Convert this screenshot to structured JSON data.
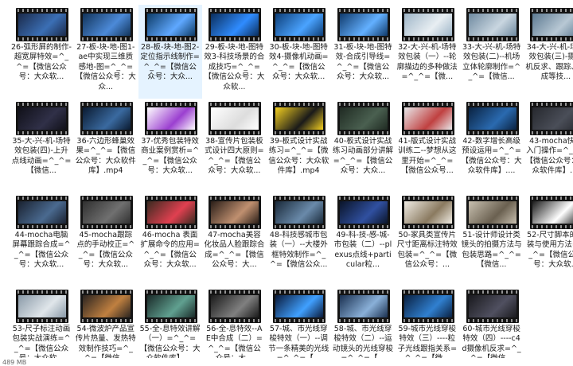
{
  "items": [
    {
      "label": "26-弧形屏的制作-超宽屏特效=^_^=【微信公众号：大众软...",
      "thumb": "#1b2a4a",
      "accent": "#3b6fb5"
    },
    {
      "label": "27-板-块-地-图1-ae中实现三维质感地-图=^_^=【微信公众号：大众...",
      "thumb": "#12345a",
      "accent": "#4c8ad8"
    },
    {
      "label": "28-板-块-地-图2-定位指示线制作=^_^=【微信公众号：大众...",
      "thumb": "#0d3b66",
      "accent": "#5fa8ff"
    },
    {
      "label": "29-板-块-地-图特效3-科技场景的合成技巧=^_^=【微信公众号：大众软...",
      "thumb": "#0b2e5c",
      "accent": "#2f8cff"
    },
    {
      "label": "30-板-块-地-图特效4-摄像机动画=^_^=【微信公众号：大众软...",
      "thumb": "#0e3f78",
      "accent": "#4aa3ff"
    },
    {
      "label": "31-板-块-地-图特效-合成引导线=^_^=【微信公众号：大众软...",
      "thumb": "#103a6b",
      "accent": "#63b0ff"
    },
    {
      "label": "32-大-兴-机-场特效包装（一）--轮廓描边的多种做法=^_^=【微...",
      "thumb": "#9fb6c8",
      "accent": "#e8eef2"
    },
    {
      "label": "33-大-兴-机-场特效包装(二)--机场立体轮廓制作=^_^=【微信...",
      "thumb": "#6f8aa0",
      "accent": "#c9d6e0"
    },
    {
      "label": "34-大-兴-机-场特效包装(三)-摄像机反求、跟踪、合成等技...",
      "thumb": "#5d7a92",
      "accent": "#b8c8d4"
    },
    {
      "label": "35-大-兴-机-场特效包装(四)-上升点线动画=^_^=【微信...",
      "thumb": "#101018",
      "accent": "#303048"
    },
    {
      "label": "36-六边形蜂巢效果=^_^=【微信公众号：大众软件库】.mp4",
      "thumb": "#0a1a30",
      "accent": "#3a6aa0"
    },
    {
      "label": "37-优秀包装特效商业案例赏析=^_^=【微信公众号：大众软...",
      "thumb": "#ffffff",
      "accent": "#9b3fd0"
    },
    {
      "label": "38-宣传片包装板式设计四大原则=^_^=【微信公众号：大众软...",
      "thumb": "#ffffff",
      "accent": "#dddddd"
    },
    {
      "label": "39-板式设计实战练习=^_^=【微信公众号：大众软件库】.mp4",
      "thumb": "#f5d020",
      "accent": "#1a1a1a"
    },
    {
      "label": "40-板式设计实战练习动画部分讲解=^_^=【微信公众号：大众...",
      "thumb": "#1f2a22",
      "accent": "#4a6050"
    },
    {
      "label": "41-版式设计实战训练二--梦想从这里开始=^_^=【微信公众号...",
      "thumb": "#e8e8ea",
      "accent": "#c04040"
    },
    {
      "label": "42-数字增长高级预设运用=^_^=【微信公众号：大众软件库】....",
      "thumb": "#0a2240",
      "accent": "#2a6ab0"
    },
    {
      "label": "43-mocha快速入门操作=^_^=【微信公众号：大众软件库】....",
      "thumb": "#26282e",
      "accent": "#4a4e58"
    },
    {
      "label": "44-mocha电脑屏幕跟踪合成=^_^=【微信公众号：大众软...",
      "thumb": "#1a2230",
      "accent": "#4a6a90"
    },
    {
      "label": "45-mocha跟踪点的手动校正=^_^=【微信公众号：大众软...",
      "thumb": "#303030",
      "accent": "#707070"
    },
    {
      "label": "46-mocha 表面扩展命令的应用=^_^=【微信公众号：大众软...",
      "thumb": "#3a2a20",
      "accent": "#e04050"
    },
    {
      "label": "47-mocha美容化妆品人脸跟踪合成=^_^=【微信公众号：大...",
      "thumb": "#2a1e18",
      "accent": "#c09070"
    },
    {
      "label": "48-科技感城市包装（一）--大楼外框特效制作=^_^=【微信公众...",
      "thumb": "#1a2a3a",
      "accent": "#6a8aaa"
    },
    {
      "label": "49-科-技-感-城-市包装（二）--plexus点线+particular粒...",
      "thumb": "#0a1428",
      "accent": "#3050a0"
    },
    {
      "label": "50-家具类宣传片尺寸距离标注特效包装=^_^=【微信公众号：...",
      "thumb": "#f0ece4",
      "accent": "#8a7a60"
    },
    {
      "label": "51-设计师设计类镜头的拍摄方法与包装思路=^_^=【微信...",
      "thumb": "#c8c0b0",
      "accent": "#6a6050"
    },
    {
      "label": "52-尺寸脚本的安装与使用方法=^_^=【微信公众号：大众软...",
      "thumb": "#1a1a1a",
      "accent": "#ffffff"
    },
    {
      "label": "53-尺子标注动画包装实战演练=^_^=【微信公众号：大众软...",
      "thumb": "#8a9aa8",
      "accent": "#e0e6ea"
    },
    {
      "label": "54-微波炉产品宣传片热量、发热特效制作技巧=^_^=【微信...",
      "thumb": "#2a2420",
      "accent": "#c08040"
    },
    {
      "label": "55-全-息特效讲解（一）=^_^=【微信公众号：大众软件库】....",
      "thumb": "#1a2a28",
      "accent": "#60a090"
    },
    {
      "label": "56-全-息特效--AE中合成（二）=^_^=【微信公众号：大...",
      "thumb": "#1a1a1a",
      "accent": "#808080"
    },
    {
      "label": "57-城、市光线穿梭特效（一）--调节一条精美的光线=^_^=【...",
      "thumb": "#0a1a3a",
      "accent": "#40a0ff"
    },
    {
      "label": "58-城、市光线穿梭特效（二）--运动镜头的光线穿梭=^_^=【...",
      "thumb": "#1a3050",
      "accent": "#8ab0d8"
    },
    {
      "label": "59-城市光线穿梭特效（三）----粒子光线跟指关系=^_^=【微...",
      "thumb": "#0a2040",
      "accent": "#3080d0"
    },
    {
      "label": "60-城市光线穿梭特效（四）----c4d摄像机反求=^_^=【微信...",
      "thumb": "#1a1a1e",
      "accent": "#505060"
    }
  ],
  "selected_index": 2,
  "status_text": "489 MB"
}
